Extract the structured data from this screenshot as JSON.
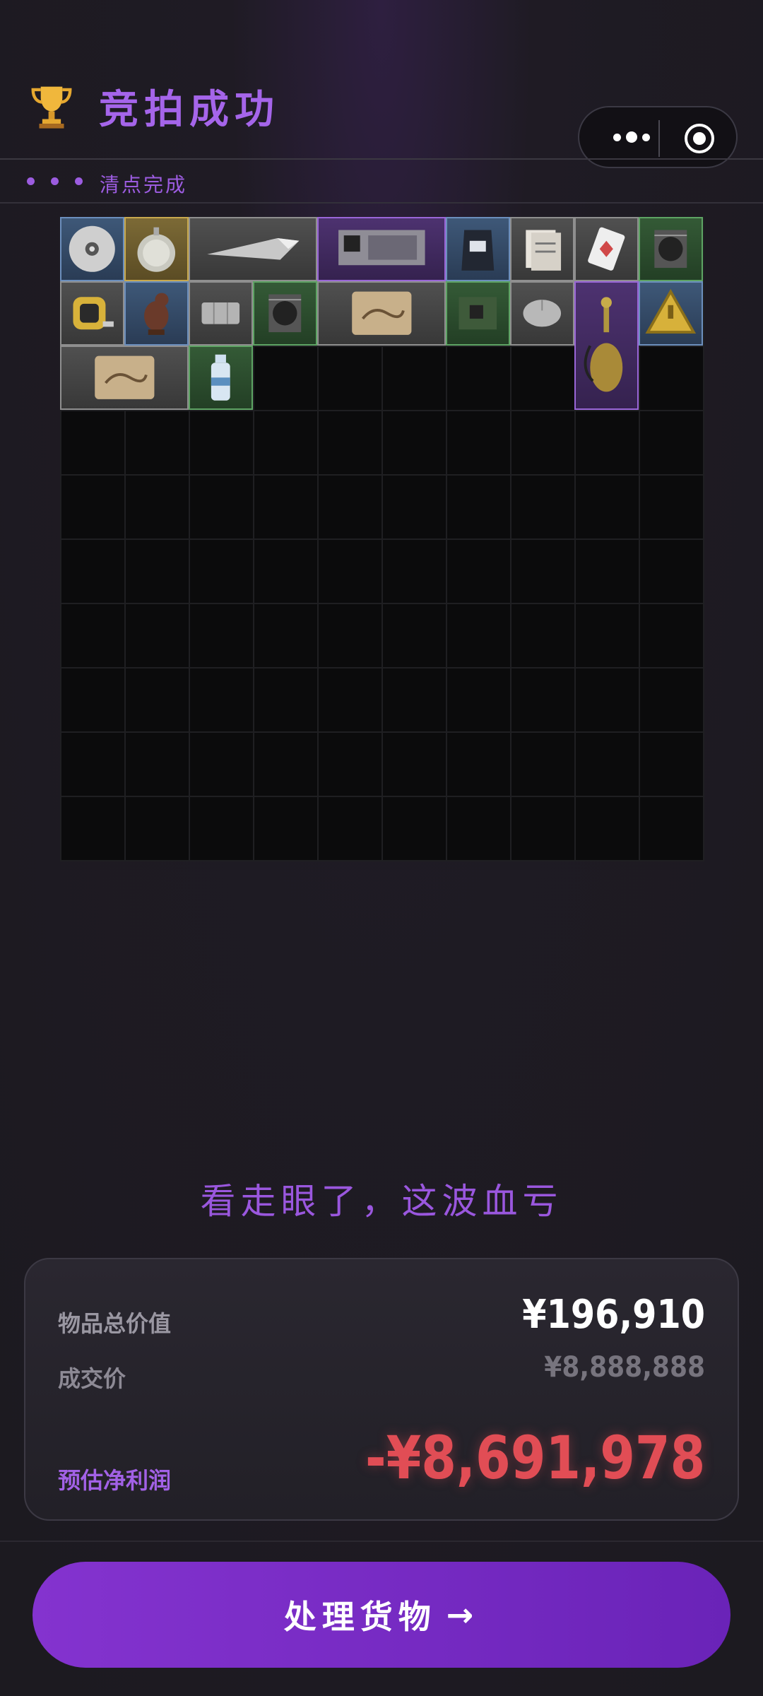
{
  "header": {
    "title": "竞拍成功",
    "trophy_icon": "trophy-icon",
    "more_icon": "more-dots-icon",
    "target_icon": "target-circle-icon",
    "status_text": "清点完成"
  },
  "inventory": {
    "grid_columns": 10,
    "grid_rows": 10,
    "items": [
      {
        "name": "cd-disc",
        "rarity": "blue"
      },
      {
        "name": "pocket-watch",
        "rarity": "gold"
      },
      {
        "name": "utility-knife",
        "rarity": "gray"
      },
      {
        "name": "circuit-board",
        "rarity": "purple"
      },
      {
        "name": "coffee-bag",
        "rarity": "blue"
      },
      {
        "name": "documents",
        "rarity": "gray"
      },
      {
        "name": "playing-card",
        "rarity": "gray"
      },
      {
        "name": "cpu-cooler",
        "rarity": "green"
      },
      {
        "name": "tape-measure",
        "rarity": "gray"
      },
      {
        "name": "bird-figurine",
        "rarity": "blue"
      },
      {
        "name": "plastic-tray",
        "rarity": "gray"
      },
      {
        "name": "cpu-cooler",
        "rarity": "green"
      },
      {
        "name": "old-map",
        "rarity": "gray"
      },
      {
        "name": "green-pcb",
        "rarity": "green"
      },
      {
        "name": "computer-mouse",
        "rarity": "gray"
      },
      {
        "name": "ornate-hookah",
        "rarity": "purple"
      },
      {
        "name": "warning-sign",
        "rarity": "blue"
      },
      {
        "name": "old-map",
        "rarity": "gray"
      },
      {
        "name": "water-bottle",
        "rarity": "green"
      }
    ]
  },
  "result": {
    "message": "看走眼了，这波血亏",
    "total_value_label": "物品总价值",
    "total_value": "¥196,910",
    "deal_price_label": "成交价",
    "deal_price": "¥8,888,888",
    "profit_label": "预估净利润",
    "profit": "-¥8,691,978"
  },
  "action": {
    "label": "处理货物",
    "arrow": "→"
  },
  "colors": {
    "accent": "#9c5ce0",
    "loss": "#e14d55",
    "button": "#7a2cc6"
  }
}
